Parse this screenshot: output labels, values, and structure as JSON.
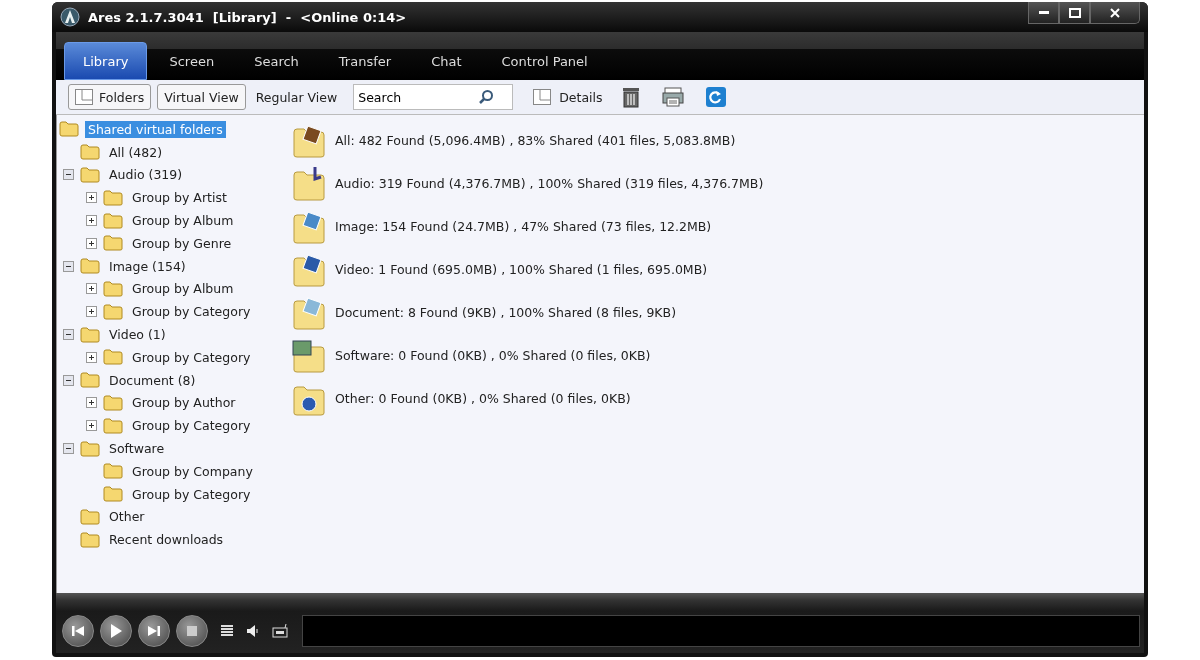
{
  "window": {
    "title": "Ares 2.1.7.3041  [Library]  -  <Online 0:14>"
  },
  "tabs": [
    {
      "label": "Library",
      "selected": true
    },
    {
      "label": "Screen",
      "selected": false
    },
    {
      "label": "Search",
      "selected": false
    },
    {
      "label": "Transfer",
      "selected": false
    },
    {
      "label": "Chat",
      "selected": false
    },
    {
      "label": "Control Panel",
      "selected": false
    }
  ],
  "toolbar": {
    "folders": "Folders",
    "virtual_view": "Virtual View",
    "regular_view": "Regular View",
    "search": {
      "value": "Search"
    },
    "details": "Details"
  },
  "tree": [
    {
      "label": "Shared virtual folders",
      "selected": true,
      "children": [
        {
          "label": "All (482)",
          "selected": false
        },
        {
          "label": "Audio (319)",
          "selected": false,
          "expanded": true,
          "children": [
            {
              "label": "Group by Artist",
              "selected": false,
              "expanded": false
            },
            {
              "label": "Group by Album",
              "selected": false,
              "expanded": false
            },
            {
              "label": "Group by Genre",
              "selected": false,
              "expanded": false
            }
          ]
        },
        {
          "label": "Image (154)",
          "selected": false,
          "expanded": true,
          "children": [
            {
              "label": "Group by Album",
              "selected": false,
              "expanded": false
            },
            {
              "label": "Group by Category",
              "selected": false,
              "expanded": false
            }
          ]
        },
        {
          "label": "Video (1)",
          "selected": false,
          "expanded": true,
          "children": [
            {
              "label": "Group by Category",
              "selected": false,
              "expanded": false
            }
          ]
        },
        {
          "label": "Document (8)",
          "selected": false,
          "expanded": true,
          "children": [
            {
              "label": "Group by Author",
              "selected": false,
              "expanded": false
            },
            {
              "label": "Group by Category",
              "selected": false,
              "expanded": false
            }
          ]
        },
        {
          "label": "Software",
          "selected": false,
          "expanded": true,
          "children": [
            {
              "label": "Group by Company",
              "selected": false
            },
            {
              "label": "Group by Category",
              "selected": false
            }
          ]
        },
        {
          "label": "Other",
          "selected": false
        },
        {
          "label": "Recent downloads",
          "selected": false
        }
      ]
    }
  ],
  "summary": [
    {
      "kind": "all",
      "text": "All: 482 Found (5,096.4MB) , 83% Shared (401 files, 5,083.8MB)"
    },
    {
      "kind": "audio",
      "text": "Audio: 319 Found (4,376.7MB) , 100% Shared (319 files, 4,376.7MB)"
    },
    {
      "kind": "image",
      "text": "Image: 154 Found (24.7MB) , 47% Shared (73 files, 12.2MB)"
    },
    {
      "kind": "video",
      "text": "Video: 1 Found (695.0MB) , 100% Shared (1 files, 695.0MB)"
    },
    {
      "kind": "document",
      "text": "Document: 8 Found (9KB) , 100% Shared (8 files, 9KB)"
    },
    {
      "kind": "software",
      "text": "Software: 0 Found (0KB) , 0% Shared (0 files, 0KB)"
    },
    {
      "kind": "other",
      "text": "Other: 0 Found (0KB) , 0% Shared (0 files, 0KB)"
    }
  ]
}
